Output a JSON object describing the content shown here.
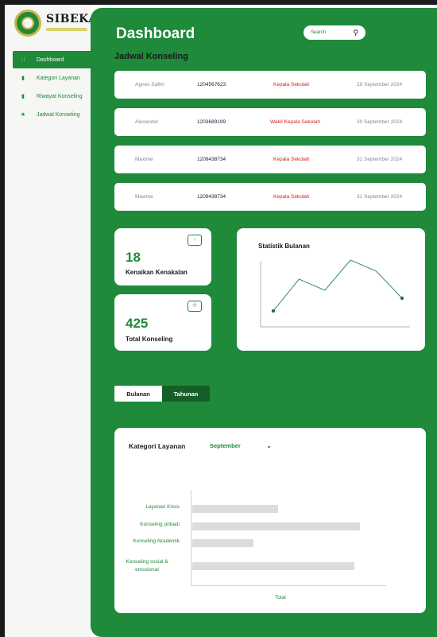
{
  "brand": {
    "name": "SIBEKA"
  },
  "sidebar": {
    "items": [
      {
        "label": "Dashboard",
        "icon": "grid-icon",
        "active": true
      },
      {
        "label": "Kategori Layanan",
        "icon": "document-icon",
        "active": false
      },
      {
        "label": "Riwayat Konseling",
        "icon": "bookmark-icon",
        "active": false
      },
      {
        "label": "Jadwal Konseling",
        "icon": "star-icon",
        "active": false
      }
    ]
  },
  "header": {
    "title": "Dashboard"
  },
  "search": {
    "placeholder": "Search"
  },
  "schedule": {
    "title": "Jadwal Konseling",
    "rows": [
      {
        "name": "Agnes Safitri",
        "id": "1204567623",
        "role": "Kepala Sekolah",
        "date": "29 September 2024"
      },
      {
        "name": "Alexander",
        "id": "1203689199",
        "role": "Wakil Kepala Sekolah",
        "date": "30 September 2024"
      },
      {
        "name": "Maxime",
        "id": "1209438734",
        "role": "Kepala Sekolah",
        "date": "31 September 2024"
      },
      {
        "name": "Maxime",
        "id": "1209438734",
        "role": "Kepala Sekolah",
        "date": "31 September 2024"
      }
    ]
  },
  "stats": {
    "kenaikan": {
      "value": "18",
      "label": "Kenaikan Kenakalan"
    },
    "total": {
      "value": "425",
      "label": "Total Konseling"
    }
  },
  "tabs": {
    "bulanan": "Bulanan",
    "tahunan": "Tahunan"
  },
  "colors": {
    "green": "#1e8a3a",
    "red": "#cc1f1f",
    "dark_green": "#165e27"
  },
  "chart_data": [
    {
      "type": "line",
      "title": "Statistik Bulanan",
      "x": [
        1,
        2,
        3,
        4,
        5,
        6
      ],
      "values": [
        1,
        3,
        2.3,
        4.2,
        3.5,
        1.8
      ],
      "ylim": [
        0,
        5
      ],
      "grid": false
    },
    {
      "type": "bar",
      "orientation": "horizontal",
      "title": "Kategori Layanan",
      "selected_month": "September",
      "categories": [
        "Layanan Krisis",
        "Konseling pribadi",
        "Konseling Akademik",
        "Konseling sosial & emosional"
      ],
      "values": [
        45,
        88,
        32,
        85
      ],
      "xlim": [
        0,
        100
      ],
      "xlabel": "Total"
    }
  ]
}
